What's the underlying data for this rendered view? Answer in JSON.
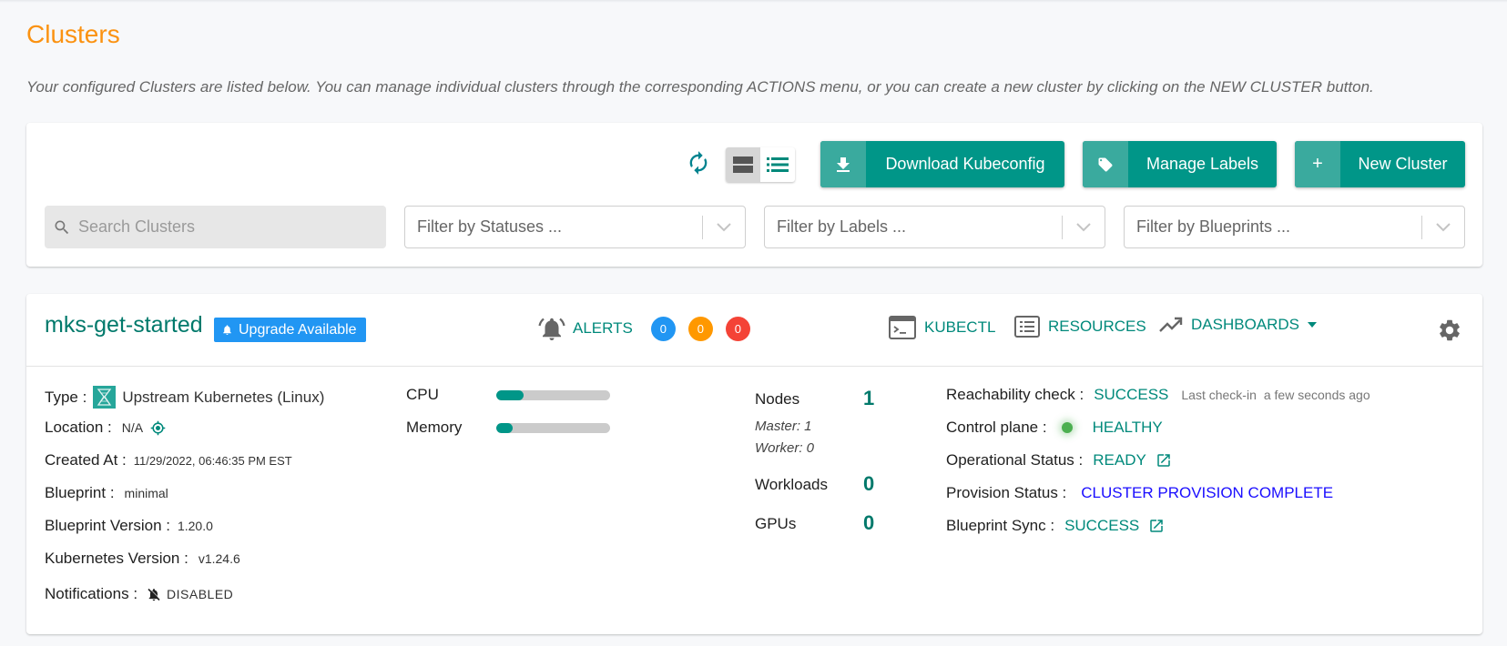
{
  "page": {
    "title": "Clusters",
    "description": "Your configured Clusters are listed below. You can manage individual clusters through the corresponding ACTIONS menu, or you can create a new cluster by clicking on the NEW CLUSTER button."
  },
  "toolbar": {
    "refresh_icon": "refresh-icon",
    "view_modes": [
      {
        "icon": "card-view-icon",
        "active": true
      },
      {
        "icon": "list-view-icon",
        "active": false
      }
    ],
    "download_kubeconfig_label": "Download Kubeconfig",
    "manage_labels_label": "Manage Labels",
    "new_cluster_label": "New Cluster",
    "new_cluster_icon_glyph": "+",
    "search": {
      "placeholder": "Search Clusters",
      "value": ""
    },
    "filters": {
      "statuses": "Filter by Statuses ...",
      "labels": "Filter by Labels ...",
      "blueprints": "Filter by Blueprints ..."
    }
  },
  "cluster": {
    "name": "mks-get-started",
    "upgrade_badge": "Upgrade Available",
    "alerts": {
      "label": "ALERTS",
      "counts": [
        {
          "value": "0",
          "color": "#2196f3"
        },
        {
          "value": "0",
          "color": "#ff9800"
        },
        {
          "value": "0",
          "color": "#f44336"
        }
      ]
    },
    "links": {
      "kubectl": "KUBECTL",
      "resources": "RESOURCES",
      "dashboards": "DASHBOARDS"
    },
    "details": {
      "type_label": "Type :",
      "type_value": "Upstream Kubernetes (Linux)",
      "location_label": "Location :",
      "location_value": "N/A",
      "created_label": "Created At :",
      "created_value": "11/29/2022, 06:46:35 PM EST",
      "blueprint_label": "Blueprint :",
      "blueprint_value": "minimal",
      "blueprint_version_label": "Blueprint Version :",
      "blueprint_version_value": "1.20.0",
      "k8s_version_label": "Kubernetes Version :",
      "k8s_version_value": "v1.24.6",
      "notifications_label": "Notifications :",
      "notifications_value": "DISABLED"
    },
    "usage": {
      "cpu_label": "CPU",
      "cpu_percent": 24,
      "memory_label": "Memory",
      "memory_percent": 14
    },
    "counts": {
      "nodes_label": "Nodes",
      "nodes_value": "1",
      "master": "Master: 1",
      "worker": "Worker: 0",
      "workloads_label": "Workloads",
      "workloads_value": "0",
      "gpus_label": "GPUs",
      "gpus_value": "0"
    },
    "status": {
      "reachability_label": "Reachability check :",
      "reachability_value": "SUCCESS",
      "last_checkin_label": "Last check-in",
      "last_checkin_value": "a few seconds ago",
      "control_plane_label": "Control plane :",
      "control_plane_value": "HEALTHY",
      "operational_label": "Operational Status :",
      "operational_value": "READY",
      "provision_label": "Provision Status :",
      "provision_value": "CLUSTER PROVISION COMPLETE",
      "blueprint_sync_label": "Blueprint Sync :",
      "blueprint_sync_value": "SUCCESS"
    }
  },
  "colors": {
    "accent": "#009688",
    "title": "#fb9211",
    "link": "#00897b",
    "provision": "#1a0dff",
    "healthy": "#4caf50"
  }
}
